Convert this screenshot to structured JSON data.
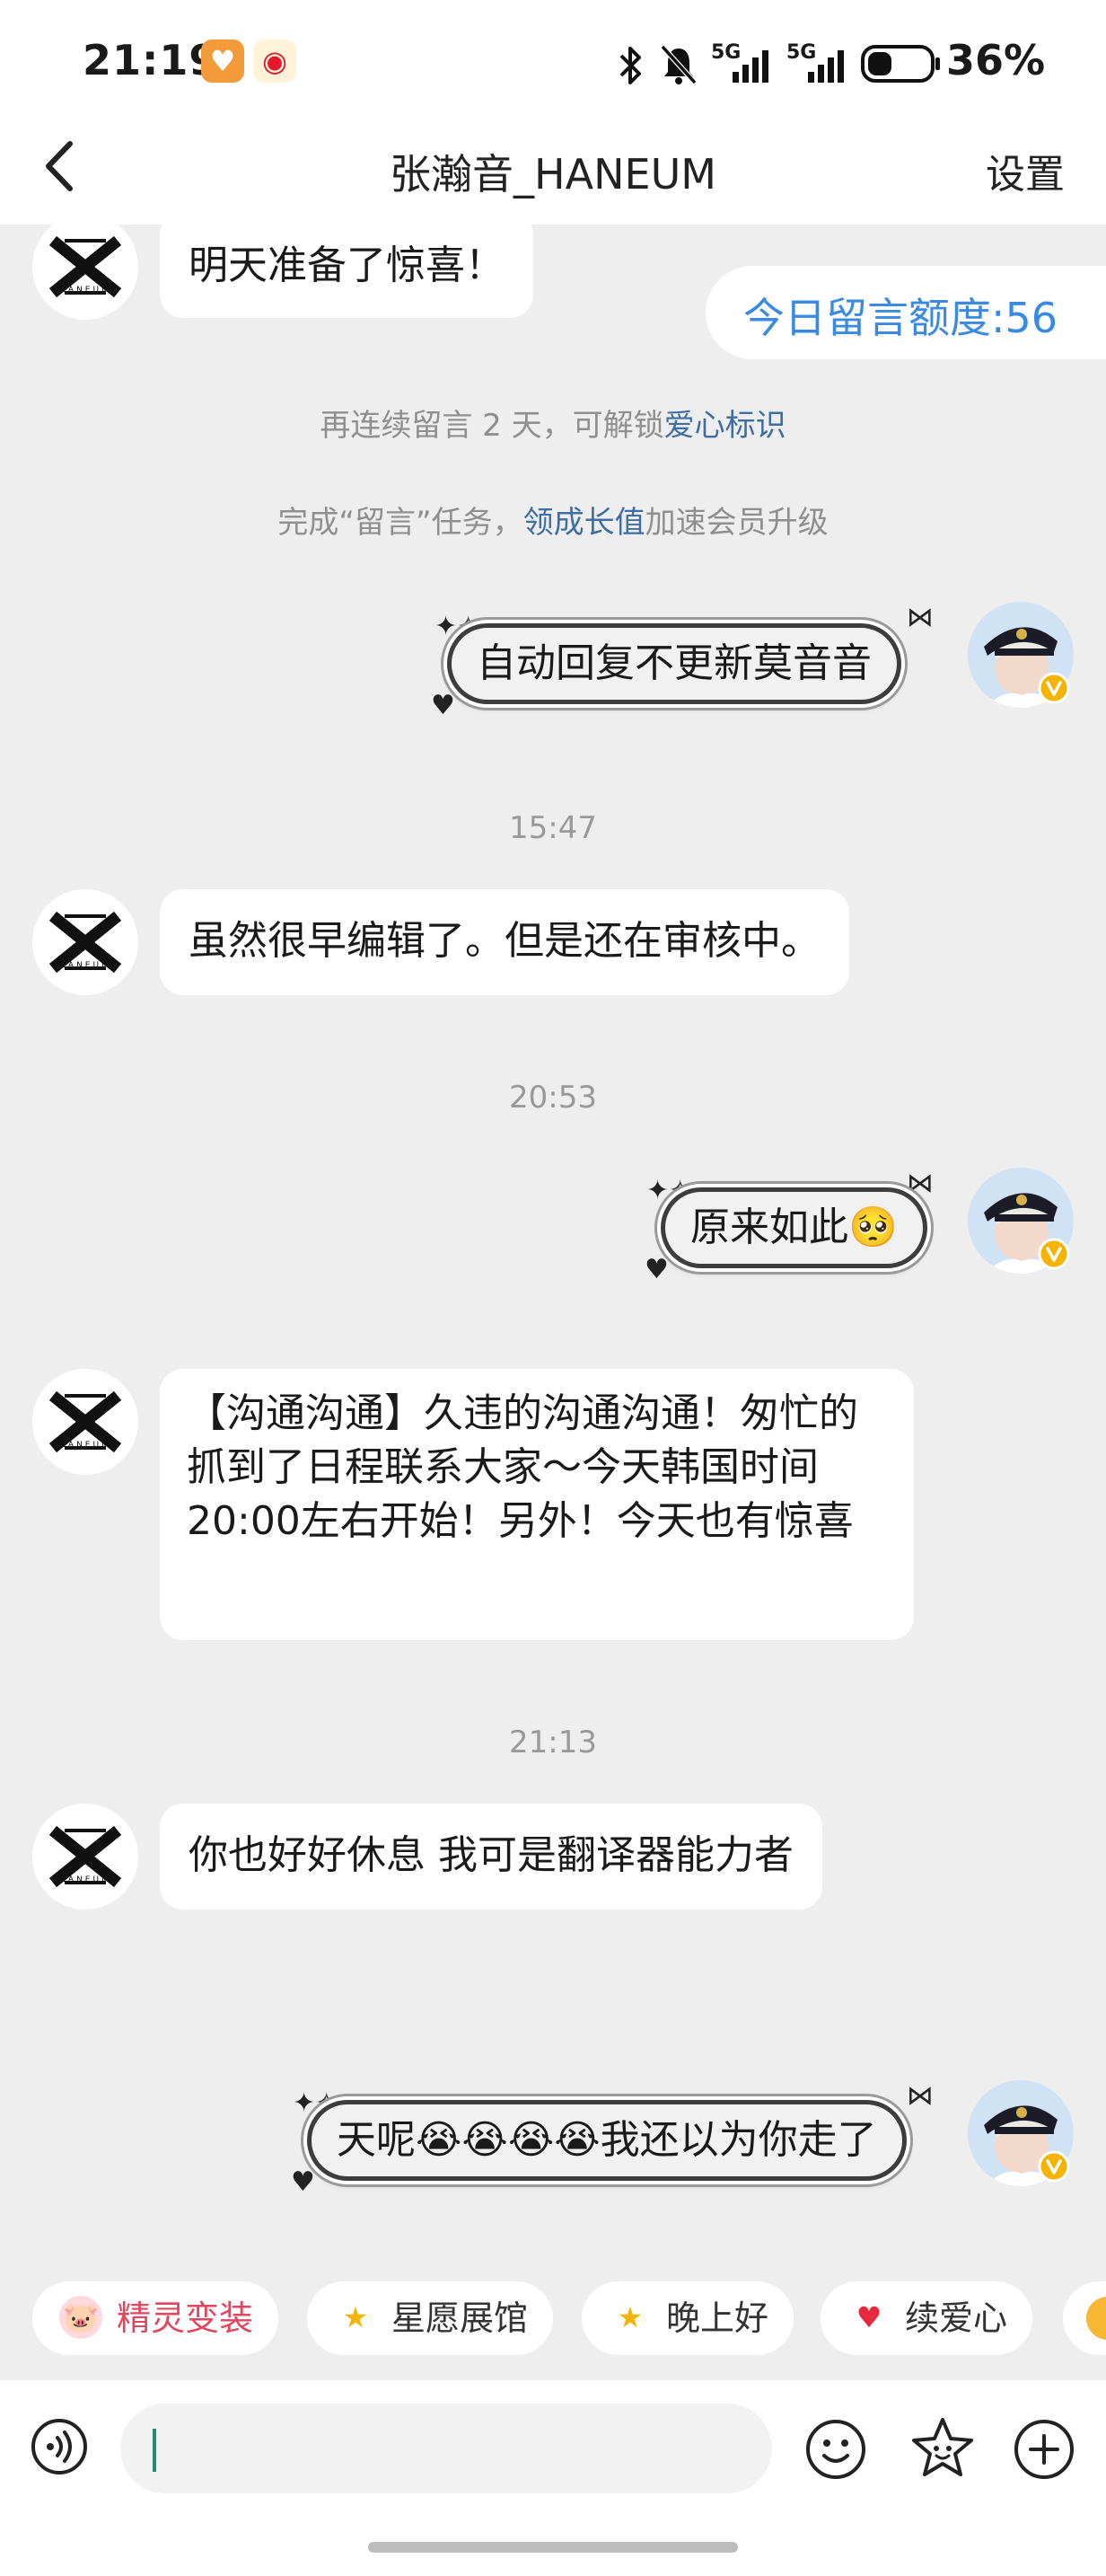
{
  "status_bar": {
    "time": "21:19",
    "battery_pct": "36%",
    "network_labels": [
      "5G",
      "5G"
    ]
  },
  "nav": {
    "title": "张瀚音_HANEUM",
    "settings_label": "设置"
  },
  "quota": {
    "text": "今日留言额度:56"
  },
  "system": {
    "streak_prefix": "再连续留言 2 天，可解锁",
    "streak_link": "爱心标识",
    "task_prefix": "完成“留言”任务，",
    "task_link": "领成长值",
    "task_suffix": "加速会员升级"
  },
  "avatar_label": "HANEUM",
  "messages": {
    "m1": "明天准备了惊喜！",
    "m2": "自动回复不更新莫音音",
    "t1": "15:47",
    "m3": "虽然很早编辑了。但是还在审核中。",
    "t2": "20:53",
    "m4": "原来如此",
    "m4_emoji": "🥺",
    "m5": "【沟通沟通】久违的沟通沟通！匆忙的抓到了日程联系大家～今天韩国时间20:00左右开始！另外！今天也有惊喜",
    "t3": "21:13",
    "m6": "你也好好休息 我可是翻译器能力者",
    "m7_pre": "天呢",
    "m7_emoji": "😭😭😭😭",
    "m7_post": "我还以为你走了"
  },
  "chips": [
    {
      "label": "精灵变装",
      "icon": "pig-face-icon",
      "color": "#e0475f"
    },
    {
      "label": "星愿展馆",
      "icon": "star-icon",
      "color": "#333333"
    },
    {
      "label": "晚上好",
      "icon": "star-face-icon",
      "color": "#333333"
    },
    {
      "label": "续爱心",
      "icon": "heart-icon",
      "color": "#333333"
    }
  ],
  "colors": {
    "accent_blue": "#3a8be0",
    "link_blue": "#3f6ea3",
    "chip_red": "#e0475f",
    "verified_gold": "#f5b400"
  }
}
